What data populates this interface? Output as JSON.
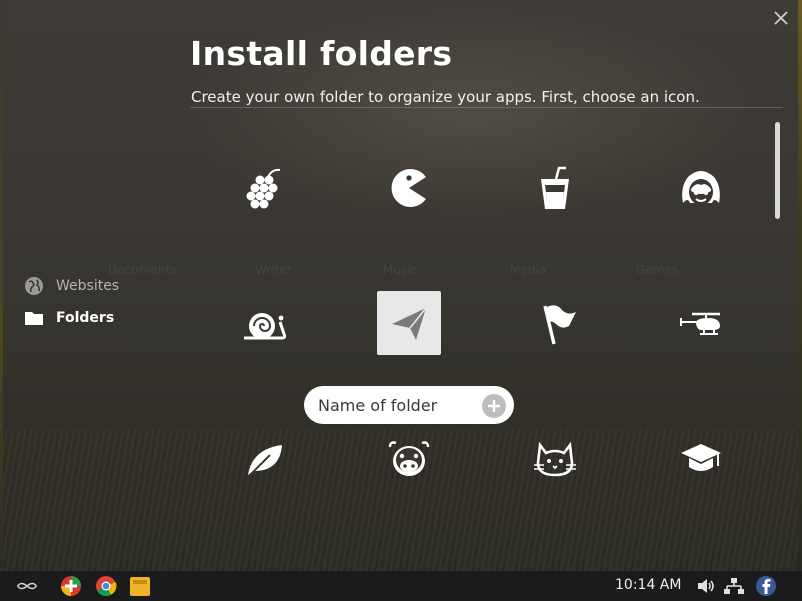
{
  "window": {
    "title": "Install folders",
    "subtitle": "Create your own folder to organize your apps. First, choose an icon.",
    "close_icon": "close-icon"
  },
  "sidebar": {
    "items": [
      {
        "label": "Websites",
        "icon": "globe-icon",
        "active": false
      },
      {
        "label": "Folders",
        "icon": "folder-icon",
        "active": true
      }
    ]
  },
  "icon_grid": {
    "icons": [
      "grapes-icon",
      "pacman-icon",
      "drink-cup-icon",
      "girl-face-icon",
      "snail-icon",
      "paper-plane-icon",
      "flag-icon",
      "helicopter-icon",
      "leaf-icon",
      "cow-icon",
      "cat-icon",
      "graduation-cap-icon"
    ],
    "selected": "paper-plane-icon"
  },
  "folder_name": {
    "placeholder": "Name of folder",
    "add_icon": "plus-icon"
  },
  "background_labels": [
    "Documents",
    "Writer",
    "Music",
    "Media",
    "Games"
  ],
  "taskbar": {
    "apps": [
      "endless-logo-icon",
      "app-store-icon",
      "chrome-icon",
      "files-icon"
    ],
    "clock": "10:14 AM",
    "tray": [
      "volume-icon",
      "network-icon",
      "facebook-icon"
    ]
  },
  "colors": {
    "accent_white": "#ffffff",
    "taskbar": "#1b1b1b",
    "overlay": "#3b3833"
  }
}
